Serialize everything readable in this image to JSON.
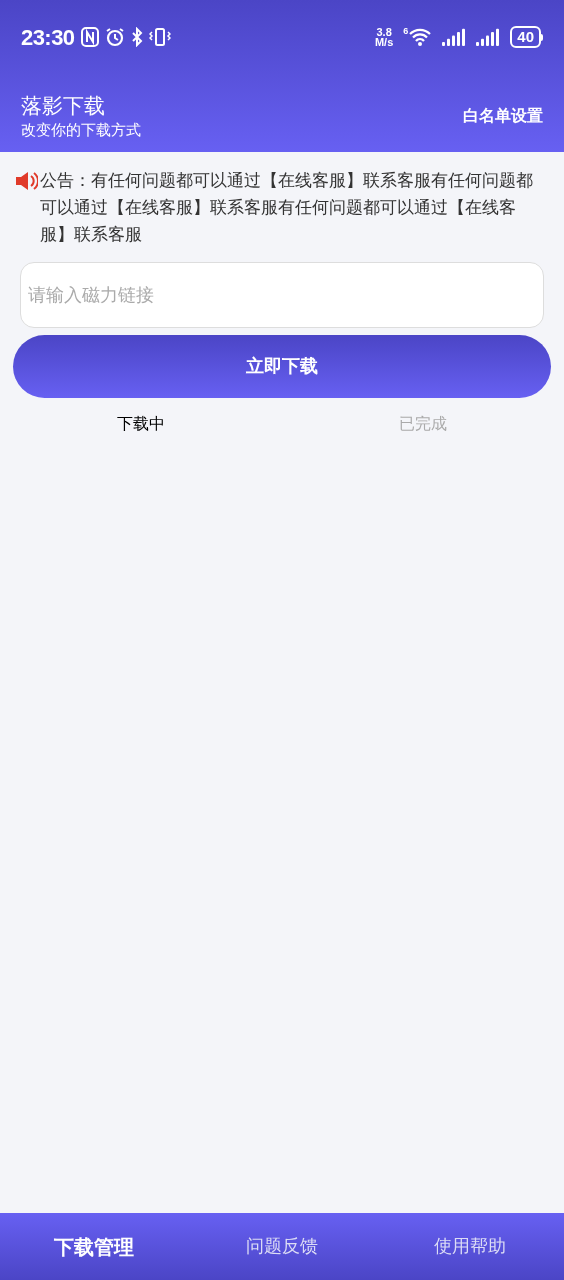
{
  "status_bar": {
    "time": "23:30",
    "speed_value": "3.8",
    "speed_unit": "M/s",
    "wifi_badge": "6",
    "battery": "40"
  },
  "header": {
    "title": "落影下载",
    "subtitle": "改变你的下载方式",
    "action": "白名单设置"
  },
  "notice": {
    "text": "公告：有任何问题都可以通过【在线客服】联系客服有任何问题都可以通过【在线客服】联系客服有任何问题都可以通过【在线客服】联系客服"
  },
  "search": {
    "placeholder": "请输入磁力链接"
  },
  "download_button": "立即下载",
  "tabs": [
    {
      "label": "下载中",
      "selected": true
    },
    {
      "label": "已完成",
      "selected": false
    }
  ],
  "bottom_nav": [
    {
      "label": "下载管理",
      "selected": true
    },
    {
      "label": "问题反馈",
      "selected": false
    },
    {
      "label": "使用帮助",
      "selected": false
    }
  ]
}
